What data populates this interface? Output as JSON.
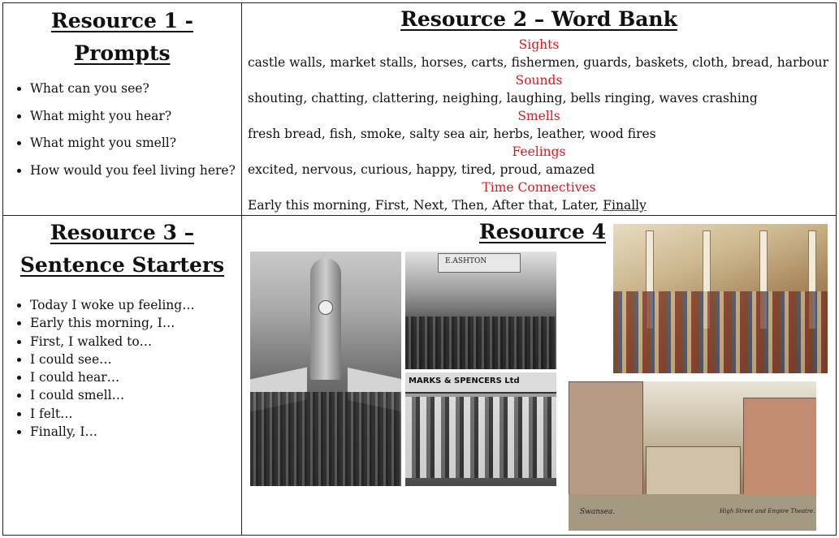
{
  "resource1": {
    "title_line1": "Resource 1 -",
    "title_line2": "Prompts",
    "prompts": [
      "What can you see?",
      "What might you hear?",
      "What might you smell?",
      "How would you feel living here?"
    ]
  },
  "resource2": {
    "title": "Resource 2 – Word Bank",
    "sections": [
      {
        "category": "Sights",
        "words": "castle walls, market stalls, horses, carts, fishermen, guards, baskets, cloth, bread, harbour"
      },
      {
        "category": "Sounds",
        "words": "shouting, chatting, clattering, neighing, laughing, bells ringing, waves crashing"
      },
      {
        "category": "Smells",
        "words": "fresh bread, fish, smoke, salty sea air, herbs, leather, wood fires"
      },
      {
        "category": "Feelings",
        "words": "excited, nervous, curious, happy, tired, proud, amazed"
      },
      {
        "category": "Time Connectives",
        "words": "Early this morning, First, Next, Then, After that, Later,",
        "last_word": "Finally"
      }
    ]
  },
  "resource3": {
    "title_line1": "Resource 3 –",
    "title_line2": "Sentence Starters",
    "starters": [
      "Today I woke up feeling…",
      "Early this morning, I…",
      "First, I walked to…",
      "I could see…",
      "I could hear…",
      "I could smell…",
      "I felt…",
      "Finally, I…"
    ]
  },
  "resource4": {
    "title": "Resource 4",
    "photos": {
      "sign_text": "E.ASHTON",
      "shop_text": "MARKS & SPENCERS Ltd",
      "postcard_left": "Swansea.",
      "postcard_right": "High Street and Empire Theatre."
    }
  },
  "colors": {
    "category": "#e8141b",
    "border": "#222222"
  }
}
